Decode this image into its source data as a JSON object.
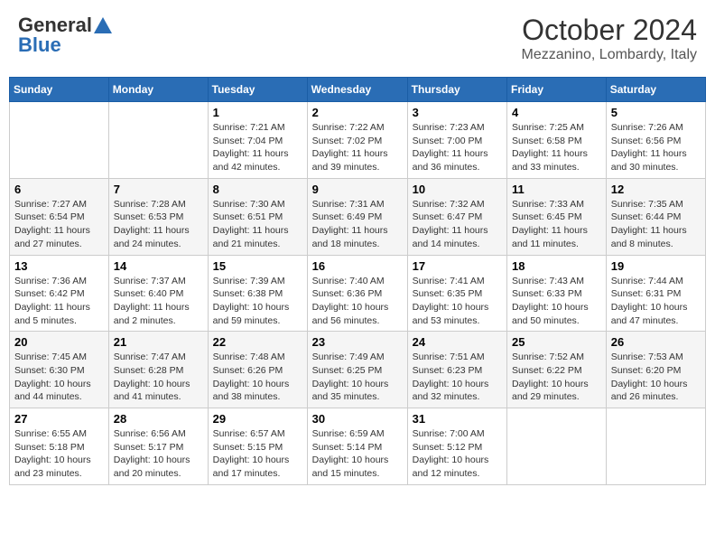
{
  "logo": {
    "general": "General",
    "blue": "Blue"
  },
  "title": "October 2024",
  "location": "Mezzanino, Lombardy, Italy",
  "days_of_week": [
    "Sunday",
    "Monday",
    "Tuesday",
    "Wednesday",
    "Thursday",
    "Friday",
    "Saturday"
  ],
  "weeks": [
    [
      {
        "day": "",
        "info": ""
      },
      {
        "day": "",
        "info": ""
      },
      {
        "day": "1",
        "info": "Sunrise: 7:21 AM\nSunset: 7:04 PM\nDaylight: 11 hours and 42 minutes."
      },
      {
        "day": "2",
        "info": "Sunrise: 7:22 AM\nSunset: 7:02 PM\nDaylight: 11 hours and 39 minutes."
      },
      {
        "day": "3",
        "info": "Sunrise: 7:23 AM\nSunset: 7:00 PM\nDaylight: 11 hours and 36 minutes."
      },
      {
        "day": "4",
        "info": "Sunrise: 7:25 AM\nSunset: 6:58 PM\nDaylight: 11 hours and 33 minutes."
      },
      {
        "day": "5",
        "info": "Sunrise: 7:26 AM\nSunset: 6:56 PM\nDaylight: 11 hours and 30 minutes."
      }
    ],
    [
      {
        "day": "6",
        "info": "Sunrise: 7:27 AM\nSunset: 6:54 PM\nDaylight: 11 hours and 27 minutes."
      },
      {
        "day": "7",
        "info": "Sunrise: 7:28 AM\nSunset: 6:53 PM\nDaylight: 11 hours and 24 minutes."
      },
      {
        "day": "8",
        "info": "Sunrise: 7:30 AM\nSunset: 6:51 PM\nDaylight: 11 hours and 21 minutes."
      },
      {
        "day": "9",
        "info": "Sunrise: 7:31 AM\nSunset: 6:49 PM\nDaylight: 11 hours and 18 minutes."
      },
      {
        "day": "10",
        "info": "Sunrise: 7:32 AM\nSunset: 6:47 PM\nDaylight: 11 hours and 14 minutes."
      },
      {
        "day": "11",
        "info": "Sunrise: 7:33 AM\nSunset: 6:45 PM\nDaylight: 11 hours and 11 minutes."
      },
      {
        "day": "12",
        "info": "Sunrise: 7:35 AM\nSunset: 6:44 PM\nDaylight: 11 hours and 8 minutes."
      }
    ],
    [
      {
        "day": "13",
        "info": "Sunrise: 7:36 AM\nSunset: 6:42 PM\nDaylight: 11 hours and 5 minutes."
      },
      {
        "day": "14",
        "info": "Sunrise: 7:37 AM\nSunset: 6:40 PM\nDaylight: 11 hours and 2 minutes."
      },
      {
        "day": "15",
        "info": "Sunrise: 7:39 AM\nSunset: 6:38 PM\nDaylight: 10 hours and 59 minutes."
      },
      {
        "day": "16",
        "info": "Sunrise: 7:40 AM\nSunset: 6:36 PM\nDaylight: 10 hours and 56 minutes."
      },
      {
        "day": "17",
        "info": "Sunrise: 7:41 AM\nSunset: 6:35 PM\nDaylight: 10 hours and 53 minutes."
      },
      {
        "day": "18",
        "info": "Sunrise: 7:43 AM\nSunset: 6:33 PM\nDaylight: 10 hours and 50 minutes."
      },
      {
        "day": "19",
        "info": "Sunrise: 7:44 AM\nSunset: 6:31 PM\nDaylight: 10 hours and 47 minutes."
      }
    ],
    [
      {
        "day": "20",
        "info": "Sunrise: 7:45 AM\nSunset: 6:30 PM\nDaylight: 10 hours and 44 minutes."
      },
      {
        "day": "21",
        "info": "Sunrise: 7:47 AM\nSunset: 6:28 PM\nDaylight: 10 hours and 41 minutes."
      },
      {
        "day": "22",
        "info": "Sunrise: 7:48 AM\nSunset: 6:26 PM\nDaylight: 10 hours and 38 minutes."
      },
      {
        "day": "23",
        "info": "Sunrise: 7:49 AM\nSunset: 6:25 PM\nDaylight: 10 hours and 35 minutes."
      },
      {
        "day": "24",
        "info": "Sunrise: 7:51 AM\nSunset: 6:23 PM\nDaylight: 10 hours and 32 minutes."
      },
      {
        "day": "25",
        "info": "Sunrise: 7:52 AM\nSunset: 6:22 PM\nDaylight: 10 hours and 29 minutes."
      },
      {
        "day": "26",
        "info": "Sunrise: 7:53 AM\nSunset: 6:20 PM\nDaylight: 10 hours and 26 minutes."
      }
    ],
    [
      {
        "day": "27",
        "info": "Sunrise: 6:55 AM\nSunset: 5:18 PM\nDaylight: 10 hours and 23 minutes."
      },
      {
        "day": "28",
        "info": "Sunrise: 6:56 AM\nSunset: 5:17 PM\nDaylight: 10 hours and 20 minutes."
      },
      {
        "day": "29",
        "info": "Sunrise: 6:57 AM\nSunset: 5:15 PM\nDaylight: 10 hours and 17 minutes."
      },
      {
        "day": "30",
        "info": "Sunrise: 6:59 AM\nSunset: 5:14 PM\nDaylight: 10 hours and 15 minutes."
      },
      {
        "day": "31",
        "info": "Sunrise: 7:00 AM\nSunset: 5:12 PM\nDaylight: 10 hours and 12 minutes."
      },
      {
        "day": "",
        "info": ""
      },
      {
        "day": "",
        "info": ""
      }
    ]
  ]
}
